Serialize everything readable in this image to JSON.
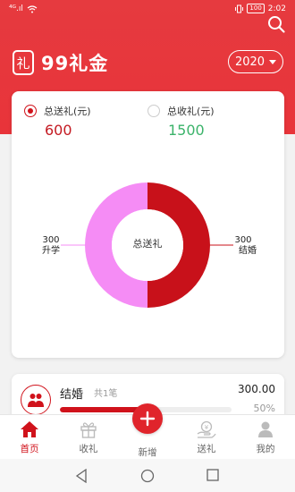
{
  "status_bar": {
    "signal": "⁴ᴳ.ıl",
    "wifi": "wifi",
    "battery": "100",
    "time": "2:02"
  },
  "header": {
    "logo_glyph": "礼",
    "app_name": "99礼金",
    "year": "2020"
  },
  "summary": {
    "sent_label": "总送礼(元)",
    "sent_value": "600",
    "received_label": "总收礼(元)",
    "received_value": "1500"
  },
  "donut": {
    "center_label": "总送礼"
  },
  "chart_data": {
    "type": "pie",
    "title": "总送礼",
    "slices": [
      {
        "label": "结婚",
        "value": 300,
        "color": "#c8111a"
      },
      {
        "label": "升学",
        "value": 300,
        "color": "#f58cf5"
      }
    ]
  },
  "donut_labels": {
    "left": {
      "value": "300",
      "name": "升学"
    },
    "right": {
      "value": "300",
      "name": "结婚"
    }
  },
  "list": [
    {
      "name": "结婚",
      "count": "共1笔",
      "amount": "300.00",
      "percent": "50%",
      "fill": 0.5
    }
  ],
  "tabs": [
    {
      "label": "首页",
      "icon": "home-icon"
    },
    {
      "label": "收礼",
      "icon": "gift-icon"
    },
    {
      "label": "新增",
      "icon": "plus-icon"
    },
    {
      "label": "送礼",
      "icon": "give-gift-icon"
    },
    {
      "label": "我的",
      "icon": "user-icon"
    }
  ],
  "colors": {
    "primary": "#e8343a",
    "accent": "#d0121b",
    "green": "#3bb36a",
    "pink": "#f58cf5"
  }
}
